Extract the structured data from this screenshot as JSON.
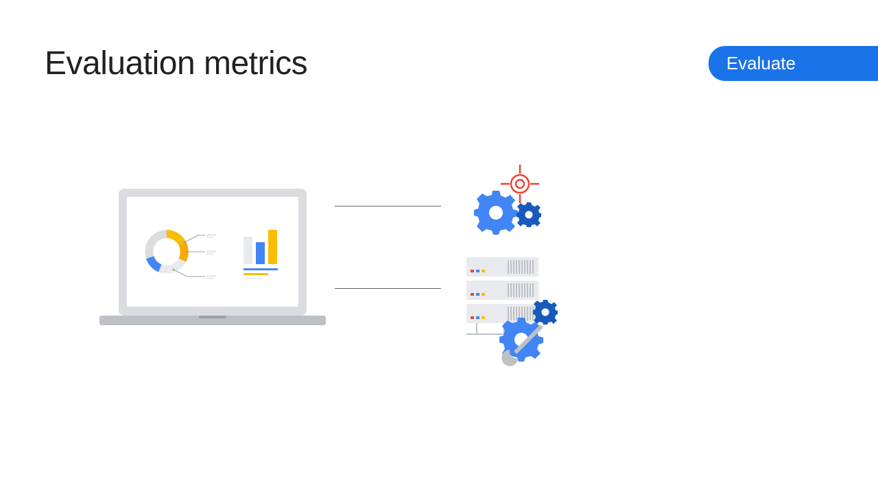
{
  "header": {
    "title": "Evaluation metrics",
    "badge_label": "Evaluate"
  },
  "colors": {
    "accent_blue": "#1a73e8",
    "google_blue": "#4285f4",
    "google_yellow": "#fbbc04",
    "google_red": "#ea4335",
    "grey_light": "#dadce0",
    "grey_mid": "#bdc1c6",
    "grey_dark": "#5f6368",
    "orange": "#f9ab00"
  },
  "icons": {
    "laptop": "laptop-analytics-icon",
    "gears_target": "gears-target-icon",
    "server_config": "server-tuning-icon"
  }
}
